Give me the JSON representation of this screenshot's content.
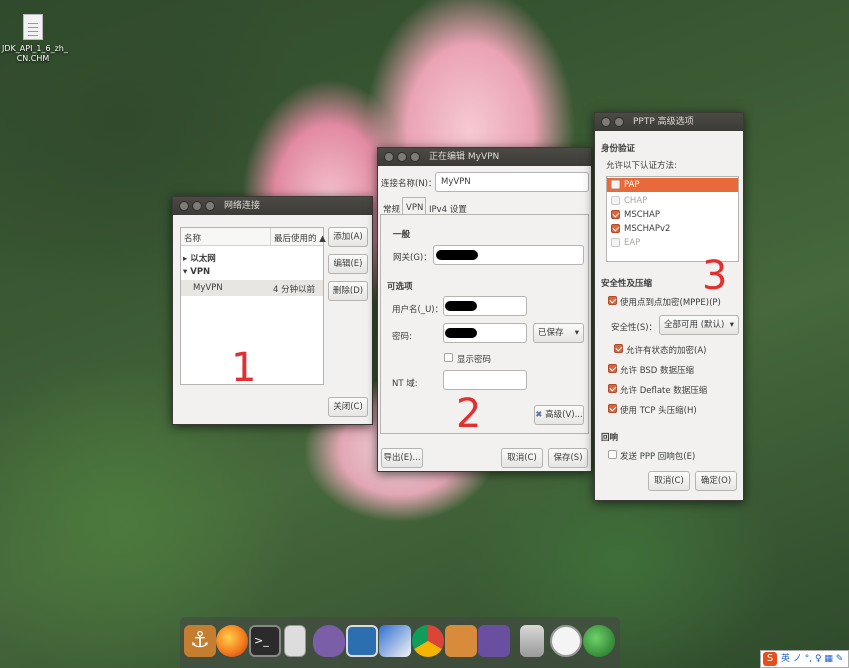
{
  "desktop": {
    "icon_label": "JDK_API_1_6_zh_\nCN.CHM"
  },
  "win1": {
    "title": "网络连接",
    "col_name": "名称",
    "col_last": "最后使用的 ▲",
    "group_ethernet": "以太网",
    "group_vpn": "VPN",
    "row_name": "MyVPN",
    "row_time": "4 分钟以前",
    "add": "添加(A)",
    "edit": "编辑(E)",
    "delete": "删除(D)",
    "close": "关闭(C)",
    "number": "1"
  },
  "win2": {
    "title": "正在编辑 MyVPN",
    "conn_name_label": "连接名称(N)：",
    "conn_name_value": "MyVPN",
    "tabs": [
      "常规",
      "VPN",
      "IPv4 设置"
    ],
    "general_heading": "一般",
    "gateway_label": "网关(G)：",
    "optional_heading": "可选项",
    "username_label": "用户名(_U)：",
    "password_label": "密码:",
    "saved_label": "已保存",
    "show_password": "显示密码",
    "nt_domain": "NT 域:",
    "advanced": "高级(V)...",
    "export": "导出(E)...",
    "cancel": "取消(C)",
    "save": "保存(S)",
    "number": "2"
  },
  "win3": {
    "title": "PPTP 高级选项",
    "auth_heading": "身份验证",
    "auth_desc": "允许以下认证方法:",
    "auth_methods": [
      "PAP",
      "CHAP",
      "MSCHAP",
      "MSCHAPv2",
      "EAP"
    ],
    "sec_heading": "安全性及压缩",
    "mppe": "使用点到点加密(MPPE)(P)",
    "security_label": "安全性(S)：",
    "security_value": "全部可用 (默认)",
    "stateful": "允许有状态的加密(A)",
    "bsd": "允许 BSD 数据压缩",
    "deflate": "允许 Deflate 数据压缩",
    "tcp_header": "使用 TCP 头压缩(H)",
    "echo_heading": "回响",
    "echo": "发送 PPP 回响包(E)",
    "cancel": "取消(C)",
    "ok": "确定(O)",
    "number": "3"
  },
  "tray": {
    "logo": "S",
    "text": "英 ノ °, ♀ ▦ ✎"
  },
  "colors": {
    "accent": "#e86a3a",
    "titlebar": "#3c3b37",
    "annotation": "#e23030"
  }
}
